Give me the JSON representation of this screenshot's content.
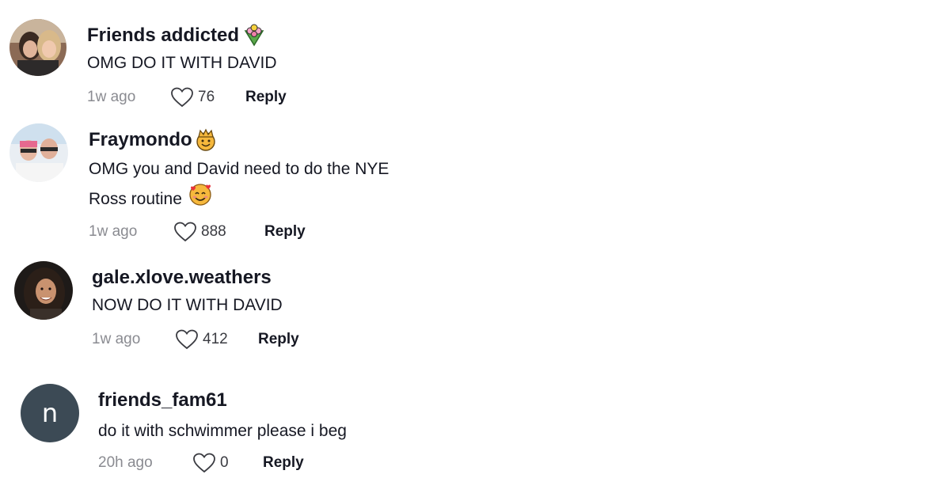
{
  "comments": [
    {
      "username": "Friends addicted",
      "badge_icon": "bouquet-icon",
      "text_lines": [
        "OMG DO IT WITH DAVID"
      ],
      "time": "1w ago",
      "likes": "76",
      "reply_label": "Reply"
    },
    {
      "username": "Fraymondo",
      "badge_icon": "crown-smiley-icon",
      "text_lines": [
        "OMG you and David need to do the NYE",
        "Ross routine"
      ],
      "text_emoji_icon": "smiling-face-with-hearts-icon",
      "time": "1w ago",
      "likes": "888",
      "reply_label": "Reply"
    },
    {
      "username": "gale.xlove.weathers",
      "text_lines": [
        "NOW DO IT WITH DAVID"
      ],
      "time": "1w ago",
      "likes": "412",
      "reply_label": "Reply"
    },
    {
      "username": "friends_fam61",
      "avatar_letter": "n",
      "text_lines": [
        "do it with schwimmer please i beg"
      ],
      "time": "20h ago",
      "likes": "0",
      "reply_label": "Reply"
    }
  ],
  "colors": {
    "username": "#161823",
    "meta": "#8a8b91",
    "letter_avatar_bg": "#3c4a55"
  }
}
